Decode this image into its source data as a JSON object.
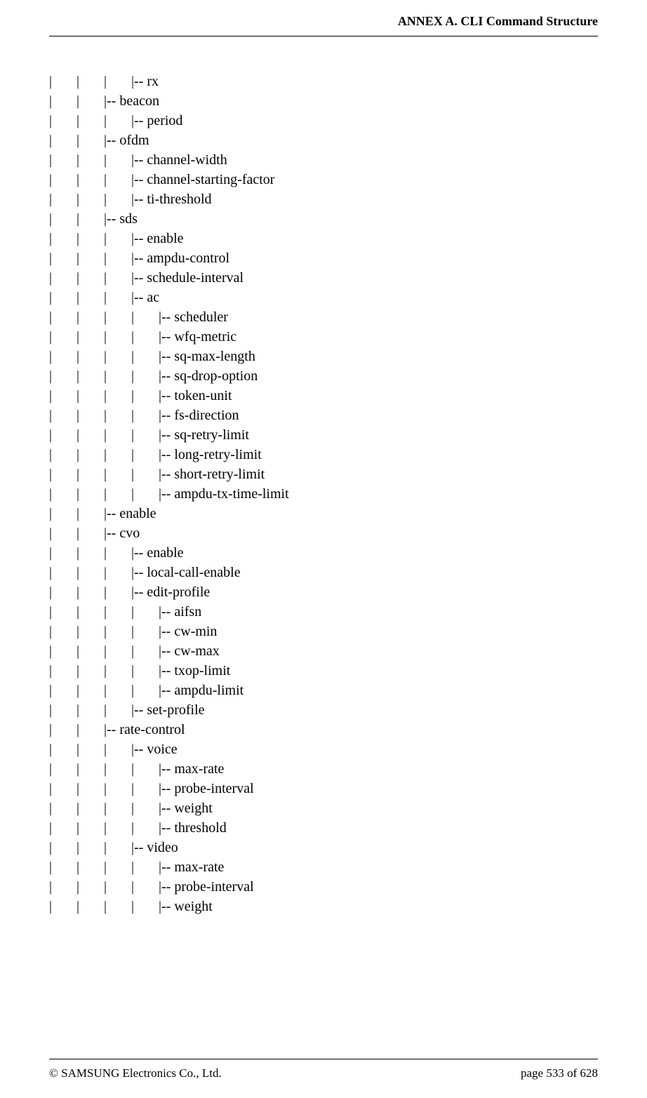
{
  "header": {
    "title": "ANNEX A. CLI Command Structure"
  },
  "lines": [
    "|       |       |       |-- rx",
    "|       |       |-- beacon",
    "|       |       |       |-- period",
    "|       |       |-- ofdm",
    "|       |       |       |-- channel-width",
    "|       |       |       |-- channel-starting-factor",
    "|       |       |       |-- ti-threshold",
    "|       |       |-- sds",
    "|       |       |       |-- enable",
    "|       |       |       |-- ampdu-control",
    "|       |       |       |-- schedule-interval",
    "|       |       |       |-- ac",
    "|       |       |       |       |-- scheduler",
    "|       |       |       |       |-- wfq-metric",
    "|       |       |       |       |-- sq-max-length",
    "|       |       |       |       |-- sq-drop-option",
    "|       |       |       |       |-- token-unit",
    "|       |       |       |       |-- fs-direction",
    "|       |       |       |       |-- sq-retry-limit",
    "|       |       |       |       |-- long-retry-limit",
    "|       |       |       |       |-- short-retry-limit",
    "|       |       |       |       |-- ampdu-tx-time-limit",
    "|       |       |-- enable",
    "|       |       |-- cvo",
    "|       |       |       |-- enable",
    "|       |       |       |-- local-call-enable",
    "|       |       |       |-- edit-profile",
    "|       |       |       |       |-- aifsn",
    "|       |       |       |       |-- cw-min",
    "|       |       |       |       |-- cw-max",
    "|       |       |       |       |-- txop-limit",
    "|       |       |       |       |-- ampdu-limit",
    "|       |       |       |-- set-profile",
    "|       |       |-- rate-control",
    "|       |       |       |-- voice",
    "|       |       |       |       |-- max-rate",
    "|       |       |       |       |-- probe-interval",
    "|       |       |       |       |-- weight",
    "|       |       |       |       |-- threshold",
    "|       |       |       |-- video",
    "|       |       |       |       |-- max-rate",
    "|       |       |       |       |-- probe-interval",
    "|       |       |       |       |-- weight"
  ],
  "footer": {
    "copyright": "© SAMSUNG Electronics Co., Ltd.",
    "page": "page 533 of 628"
  }
}
